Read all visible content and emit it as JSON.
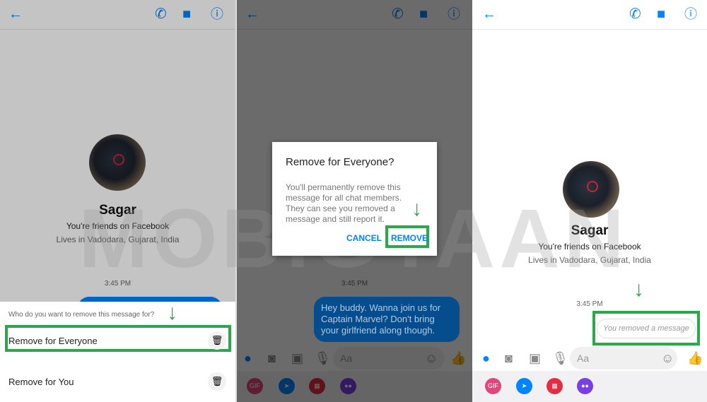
{
  "header": {
    "icons": [
      "back-arrow-icon",
      "phone-icon",
      "video-camera-icon",
      "info-icon"
    ]
  },
  "profile": {
    "name": "Sagar",
    "friends": "You're friends on Facebook",
    "location": "Lives in Vadodara, Gujarat, India"
  },
  "timestamp": "3:45 PM",
  "message": "Hey buddy. Wanna join us for Captain Marvel? Don't bring your girlfriend along though.",
  "composer": {
    "placeholder": "Aa"
  },
  "tray": {
    "gif": "GIF",
    "colors": {
      "gif": "#e0457b",
      "location": "#0084ff",
      "calendar": "#e42d42",
      "games": "#7a3fe4"
    }
  },
  "sheet": {
    "question": "Who do you want to remove this message for?",
    "options": [
      {
        "label": "Remove for Everyone"
      },
      {
        "label": "Remove for You"
      }
    ]
  },
  "dialog": {
    "title": "Remove for Everyone?",
    "body": "You'll permanently remove this message for all chat members. They can see you removed a message and still report it.",
    "cancel": "CANCEL",
    "remove": "REMOVE"
  },
  "removed_message": "You removed a message",
  "watermark": "MOBIGYAAN",
  "colors": {
    "accent": "#0084ff",
    "highlight": "#2aa84a"
  }
}
